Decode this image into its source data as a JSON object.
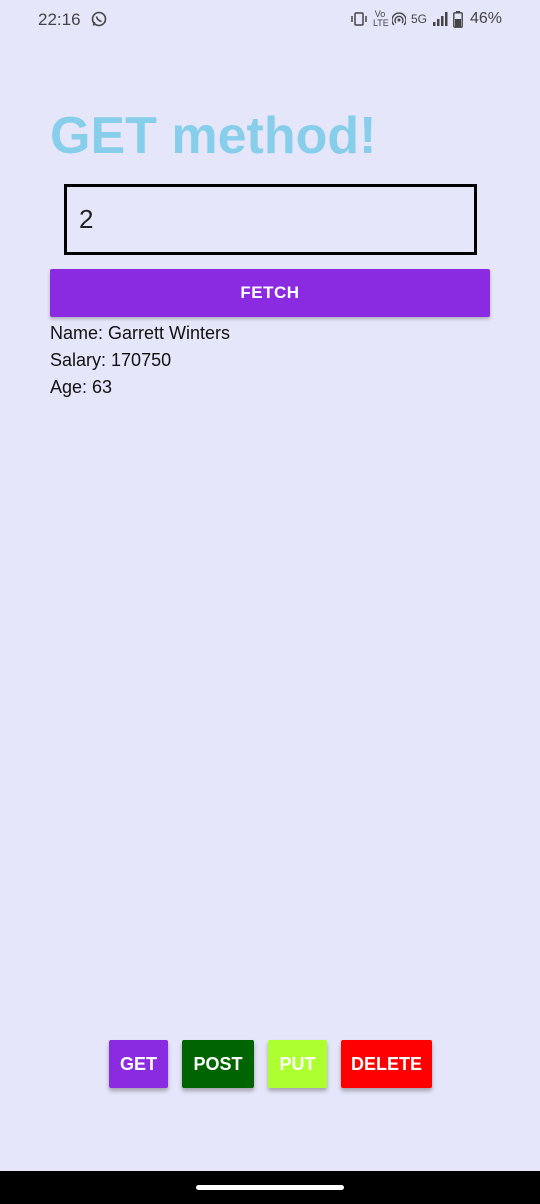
{
  "status_bar": {
    "time": "22:16",
    "network_volte": "Vo LTE",
    "network_5g": "5G",
    "battery": "46%"
  },
  "icons": {
    "whatsapp": "whatsapp-icon",
    "vibrate": "vibrate-icon",
    "hotspot": "hotspot-icon",
    "signal": "signal-icon",
    "battery": "battery-icon"
  },
  "page": {
    "title": "GET method!",
    "title_color": "#87CEEB",
    "background": "#E6E6FA"
  },
  "form": {
    "id_value": "2",
    "fetch_label": "FETCH"
  },
  "result": {
    "name_label": "Name:",
    "name_value": "Garrett Winters",
    "salary_label": "Salary:",
    "salary_value": "170750",
    "age_label": "Age:",
    "age_value": "63"
  },
  "methods": {
    "get": "GET",
    "post": "POST",
    "put": "PUT",
    "delete": "DELETE",
    "colors": {
      "get": "#8A2BE2",
      "post": "#006400",
      "put": "#ADFF2F",
      "delete": "#FF0000"
    }
  }
}
